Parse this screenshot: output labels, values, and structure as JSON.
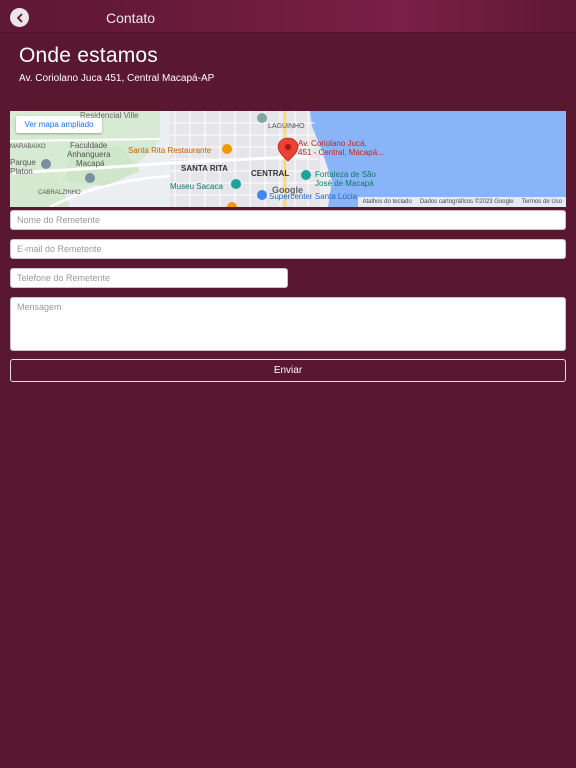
{
  "header": {
    "title": "Contato",
    "back_icon": "chevron-left-icon"
  },
  "section": {
    "title": "Onde estamos",
    "address": "Av. Coriolano Juca 451, Central Macapá-AP"
  },
  "map": {
    "view_larger_label": "Ver mapa ampliado",
    "place_labels": {
      "laguinho": "LAGUINHO",
      "marabaixo": "MARABAIXO",
      "parque_platon_1": "Parque",
      "parque_platon_2": "Platon",
      "faculdade_1": "Faculdade",
      "faculdade_2": "Anhanguera",
      "faculdade_3": "Macapá",
      "cabralzinho": "CABRALZINHO",
      "santa_rita_restaurante": "Santa Rita Restaurante",
      "santa_rita": "SANTA RITA",
      "central": "CENTRAL",
      "museu_sacaca": "Museu Sacaca",
      "pin_label_1": "Av. Coriolano Jucá,",
      "pin_label_2": "451 - Central, Macapá...",
      "fortaleza_1": "Fortaleza de São",
      "fortaleza_2": "José de Macapá",
      "supercenter": "Supercenter Santa Lúcia",
      "partial_top": "Residencial Ville"
    },
    "footer": {
      "keyboard": "Atalhos do teclado",
      "map_data": "Dados cartográficos ©2023 Google",
      "terms": "Termos de Uso"
    },
    "google_logo": "Google"
  },
  "form": {
    "name_placeholder": "Nome do Remetente",
    "email_placeholder": "E-mail do Remetente",
    "phone_placeholder": "Telefone do Remetente",
    "message_placeholder": "Mensagem",
    "submit_label": "Enviar"
  },
  "colors": {
    "background": "#5a1730",
    "header": "#6a1a3c",
    "water": "#8ab4f8",
    "pin": "#ea4335"
  }
}
